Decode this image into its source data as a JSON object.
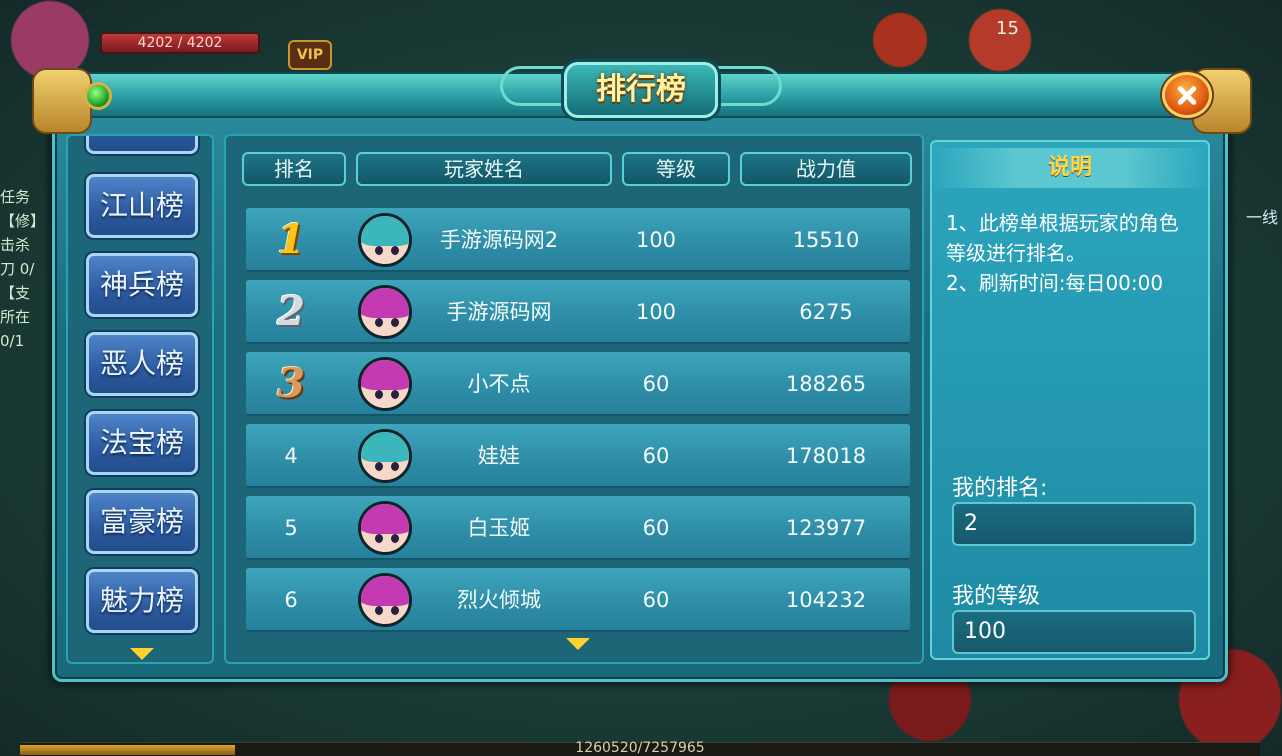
{
  "hud": {
    "hp_text": "4202 / 4202",
    "vip_label": "VIP",
    "top_counter": "15",
    "task_lines": [
      "任务",
      "【修】",
      "击杀",
      "刀 0/",
      "【支",
      "所在",
      "0/1"
    ],
    "right_line_label": "一线",
    "exp_text": "1260520/7257965",
    "exp_fraction": 0.1737
  },
  "title": "排行榜",
  "categories": [
    "江山榜",
    "神兵榜",
    "恶人榜",
    "法宝榜",
    "富豪榜",
    "魅力榜"
  ],
  "table": {
    "headers": {
      "rank": "排名",
      "name": "玩家姓名",
      "level": "等级",
      "power": "战力值"
    },
    "rows": [
      {
        "rank": "1",
        "medal": "gold",
        "avatar": "teal",
        "name": "手游源码网2",
        "level": "100",
        "power": "15510"
      },
      {
        "rank": "2",
        "medal": "silver",
        "avatar": "pink",
        "name": "手游源码网",
        "level": "100",
        "power": "6275"
      },
      {
        "rank": "3",
        "medal": "bronze",
        "avatar": "pink",
        "name": "小不点",
        "level": "60",
        "power": "188265"
      },
      {
        "rank": "4",
        "medal": "",
        "avatar": "teal",
        "name": "娃娃",
        "level": "60",
        "power": "178018"
      },
      {
        "rank": "5",
        "medal": "",
        "avatar": "pink",
        "name": "白玉姬",
        "level": "60",
        "power": "123977"
      },
      {
        "rank": "6",
        "medal": "",
        "avatar": "pink",
        "name": "烈火倾城",
        "level": "60",
        "power": "104232"
      }
    ]
  },
  "info": {
    "title": "说明",
    "line1": "1、此榜单根据玩家的角色等级进行排名。",
    "line2": "2、刷新时间:每日00:00",
    "my_rank_label": "我的排名:",
    "my_rank_value": "2",
    "my_level_label": "我的等级",
    "my_level_value": "100"
  },
  "colors": {
    "panel_teal": "#1b6e80",
    "title_gold": "#fff3a0",
    "info_title": "#ffd84a",
    "category_blue": "#2c5aa0",
    "scroll_arrow": "#ffd030"
  }
}
